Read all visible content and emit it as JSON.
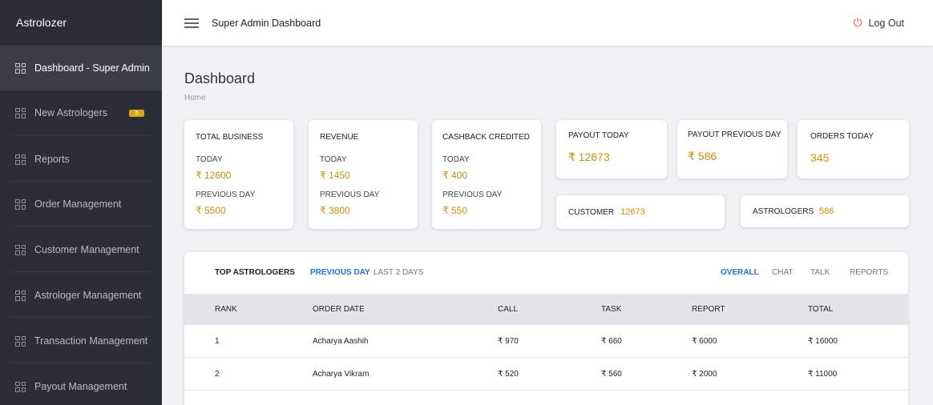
{
  "sidebar": {
    "brand": "Astrolozer",
    "items": [
      {
        "label": "Dashboard - Super Admin"
      },
      {
        "label": "New Astrologers",
        "badge": "5"
      },
      {
        "label": "Reports"
      },
      {
        "label": "Order Management"
      },
      {
        "label": "Customer Management"
      },
      {
        "label": "Astrologer Management"
      },
      {
        "label": "Transaction Management"
      },
      {
        "label": "Payout Management"
      }
    ]
  },
  "header": {
    "title": "Super Admin Dashboard",
    "logout": "Log Out"
  },
  "page": {
    "title": "Dashboard",
    "breadcrumb": "Home"
  },
  "cards": {
    "total_business": {
      "title": "TOTAL BUSINESS",
      "today_label": "TODAY",
      "today": "₹ 12600",
      "prev_label": "PREVIOUS DAY",
      "prev": "₹ 5500"
    },
    "revenue": {
      "title": "REVENUE",
      "today_label": "TODAY",
      "today": "₹ 1450",
      "prev_label": "PREVIOUS DAY",
      "prev": "₹ 3800"
    },
    "cashback": {
      "title": "CASHBACK CREDITED",
      "today_label": "TODAY",
      "today": "₹ 400",
      "prev_label": "PREVIOUS DAY",
      "prev": "₹ 550"
    },
    "payout_today": {
      "title": "PAYOUT TODAY",
      "value": "₹ 12673"
    },
    "payout_prev": {
      "title": "PAYOUT PREVIOUS DAY",
      "value": "₹ 586"
    },
    "orders_today": {
      "title": "ORDERS TODAY",
      "value": "345"
    },
    "customer": {
      "title": "CUSTOMER",
      "value": "12673"
    },
    "astrologers": {
      "title": "ASTROLOGERS",
      "value": "586"
    }
  },
  "table": {
    "title": "TOP ASTROLOGERS",
    "period_tabs": [
      "PREVIOUS DAY",
      "LAST 2 DAYS"
    ],
    "type_tabs": [
      "OVERALL",
      "CHAT",
      "TALK",
      "REPORTS"
    ],
    "columns": [
      "RANK",
      "ORDER DATE",
      "CALL",
      "TASK",
      "REPORT",
      "TOTAL"
    ],
    "rows": [
      [
        "1",
        "Acharya Aashih",
        "₹ 970",
        "₹ 660",
        "₹ 6000",
        "₹ 16000"
      ],
      [
        "2",
        "Acharya Vikram",
        "₹ 520",
        "₹ 560",
        "₹ 2000",
        "₹ 11000"
      ]
    ]
  },
  "colors": {
    "sidebar_bg": "#2b2d38",
    "accent_value": "#d18f00",
    "active_tab": "#1a73e8",
    "logout_icon": "#e4574a"
  }
}
